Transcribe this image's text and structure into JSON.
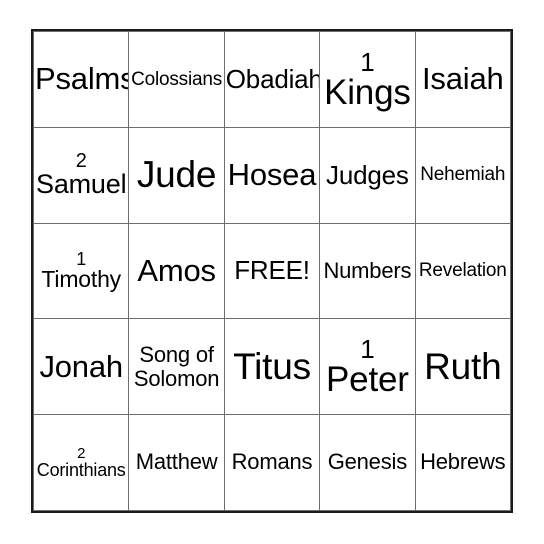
{
  "card": {
    "name": "bible-books-bingo-card",
    "free_space_label": "FREE!",
    "border_color": "#1a1a1a",
    "grid_line_color": "#6e6e6e",
    "text_color": "#000000",
    "background_color": "#ffffff",
    "columns": 5,
    "rows": 5,
    "cells": [
      [
        {
          "text": "Psalms",
          "size": "lg",
          "layout": "single"
        },
        {
          "text": "Colossians",
          "size": "xs",
          "layout": "single"
        },
        {
          "text": "Obadiah",
          "size": "md",
          "layout": "single"
        },
        {
          "number": "1",
          "word": "Kings",
          "size": "xl",
          "layout": "stacked"
        },
        {
          "text": "Isaiah",
          "size": "lg",
          "layout": "single"
        }
      ],
      [
        {
          "number": "2",
          "word": "Samuel",
          "size": "md",
          "layout": "stacked"
        },
        {
          "text": "Jude",
          "size": "xl",
          "layout": "single"
        },
        {
          "text": "Hosea",
          "size": "lg",
          "layout": "single"
        },
        {
          "text": "Judges",
          "size": "md",
          "layout": "single"
        },
        {
          "text": "Nehemiah",
          "size": "xs",
          "layout": "single"
        }
      ],
      [
        {
          "number": "1",
          "word": "Timothy",
          "size": "sm",
          "layout": "stacked"
        },
        {
          "text": "Amos",
          "size": "lg",
          "layout": "single"
        },
        {
          "text": "FREE!",
          "size": "md",
          "layout": "single"
        },
        {
          "text": "Numbers",
          "size": "sm",
          "layout": "single"
        },
        {
          "text": "Revelation",
          "size": "xs",
          "layout": "single"
        }
      ],
      [
        {
          "text": "Jonah",
          "size": "lg",
          "layout": "single"
        },
        {
          "line1": "Song of",
          "line2": "Solomon",
          "layout": "two-line"
        },
        {
          "text": "Titus",
          "size": "xl",
          "layout": "single"
        },
        {
          "number": "1",
          "word": "Peter",
          "size": "xl",
          "layout": "stacked"
        },
        {
          "text": "Ruth",
          "size": "xl",
          "layout": "single"
        }
      ],
      [
        {
          "number": "2",
          "word": "Corinthians",
          "size": "xs",
          "layout": "stacked"
        },
        {
          "text": "Matthew",
          "size": "sm",
          "layout": "single"
        },
        {
          "text": "Romans",
          "size": "sm",
          "layout": "single"
        },
        {
          "text": "Genesis",
          "size": "sm",
          "layout": "single"
        },
        {
          "text": "Hebrews",
          "size": "sm",
          "layout": "single"
        }
      ]
    ]
  }
}
